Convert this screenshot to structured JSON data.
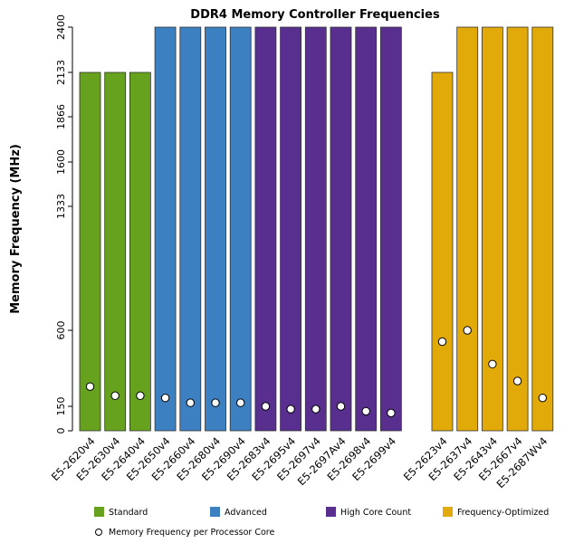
{
  "chart_data": {
    "type": "bar",
    "title": "DDR4 Memory Controller Frequencies",
    "xlabel": "",
    "ylabel": "Memory Frequency (MHz)",
    "y_ticks": [
      0,
      150,
      600,
      1333,
      1600,
      1866,
      2133,
      2400
    ],
    "ylim": [
      0,
      2400
    ],
    "y_scale_note": "piecewise axis: tick labels evenly reflect memory speeds",
    "grid": false,
    "legend_position": "bottom",
    "categories": [
      "E5-2620v4",
      "E5-2630v4",
      "E5-2640v4",
      "E5-2650v4",
      "E5-2660v4",
      "E5-2680v4",
      "E5-2690v4",
      "E5-2683v4",
      "E5-2695v4",
      "E5-2697v4",
      "E5-2697Av4",
      "E5-2698v4",
      "E5-2699v4",
      "E5-2623v4",
      "E5-2637v4",
      "E5-2643v4",
      "E5-2667v4",
      "E5-2687Wv4"
    ],
    "groups": [
      "Standard",
      "Standard",
      "Standard",
      "Advanced",
      "Advanced",
      "Advanced",
      "Advanced",
      "High Core Count",
      "High Core Count",
      "High Core Count",
      "High Core Count",
      "High Core Count",
      "High Core Count",
      "Frequency-Optimized",
      "Frequency-Optimized",
      "Frequency-Optimized",
      "Frequency-Optimized",
      "Frequency-Optimized"
    ],
    "series": [
      {
        "name": "Memory Frequency",
        "type": "bar",
        "values": [
          2133,
          2133,
          2133,
          2400,
          2400,
          2400,
          2400,
          2400,
          2400,
          2400,
          2400,
          2400,
          2400,
          2133,
          2400,
          2400,
          2400,
          2400
        ]
      },
      {
        "name": "Memory Frequency per Processor Core",
        "type": "scatter",
        "values": [
          267,
          213,
          213,
          200,
          171,
          171,
          171,
          150,
          133,
          133,
          150,
          120,
          109,
          533,
          600,
          400,
          300,
          200
        ]
      }
    ],
    "legend": [
      {
        "label": "Standard",
        "color": "#67a21e"
      },
      {
        "label": "Advanced",
        "color": "#3d80c2"
      },
      {
        "label": "High Core Count",
        "color": "#582f8f"
      },
      {
        "label": "Frequency-Optimized",
        "color": "#e2aa09"
      },
      {
        "label": "Memory Frequency per Processor Core",
        "marker": "circle"
      }
    ],
    "colors": {
      "Standard": "#67a21e",
      "Advanced": "#3d80c2",
      "High Core Count": "#582f8f",
      "Frequency-Optimized": "#e2aa09"
    }
  }
}
